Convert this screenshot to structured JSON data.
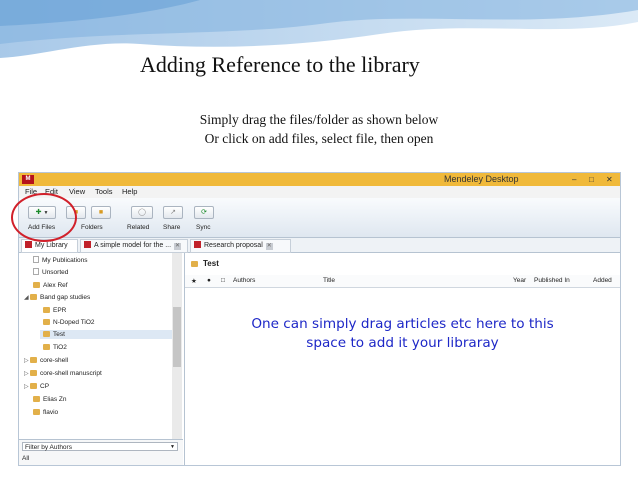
{
  "slide": {
    "title": "Adding Reference to the library",
    "subtitle_line1": "Simply drag the files/folder as shown below",
    "subtitle_line2": "Or click on add files, select file, then open"
  },
  "window": {
    "logo_text": "M",
    "title": "Mendeley Desktop",
    "controls": [
      "–",
      "□",
      "✕"
    ]
  },
  "menu": [
    "File",
    "Edit",
    "View",
    "Tools",
    "Help"
  ],
  "toolbar": {
    "add_files_label": "Add Files",
    "folders_label": "Folders",
    "related_label": "Related",
    "share_label": "Share",
    "sync_label": "Sync"
  },
  "tabs": [
    {
      "label": "My Library"
    },
    {
      "label": "A simple model for the ..."
    },
    {
      "label": "Research proposal"
    }
  ],
  "sidebar": {
    "items": [
      {
        "label": "My Publications",
        "icon": "doc-icon"
      },
      {
        "label": "Unsorted",
        "icon": "doc-icon"
      },
      {
        "label": "Alex Ref",
        "icon": "folder-icon"
      },
      {
        "label": "Band gap studies",
        "icon": "folder-icon"
      },
      {
        "label": "EPR",
        "icon": "folder-icon"
      },
      {
        "label": "N-Doped TiO2",
        "icon": "folder-icon"
      },
      {
        "label": "Test",
        "icon": "folder-icon"
      },
      {
        "label": "TiO2",
        "icon": "folder-icon"
      },
      {
        "label": "core-shell",
        "icon": "folder-icon"
      },
      {
        "label": "core-shell manuscript",
        "icon": "folder-icon"
      },
      {
        "label": "CP",
        "icon": "folder-icon"
      },
      {
        "label": "Elias Zn",
        "icon": "folder-icon"
      },
      {
        "label": "flavio",
        "icon": "folder-icon"
      }
    ],
    "filter_label": "Filter by Authors",
    "filter_value": "All"
  },
  "main": {
    "folder_name": "Test",
    "columns": [
      "Authors",
      "Title",
      "Year",
      "Published In",
      "Added"
    ],
    "overlay_line1": "One can simply drag articles etc here to this",
    "overlay_line2": "space to add it your libraray"
  },
  "colors": {
    "accent_red": "#d1202a",
    "overlay_text": "#1d27c7",
    "titlebar": "#f0b93a"
  }
}
